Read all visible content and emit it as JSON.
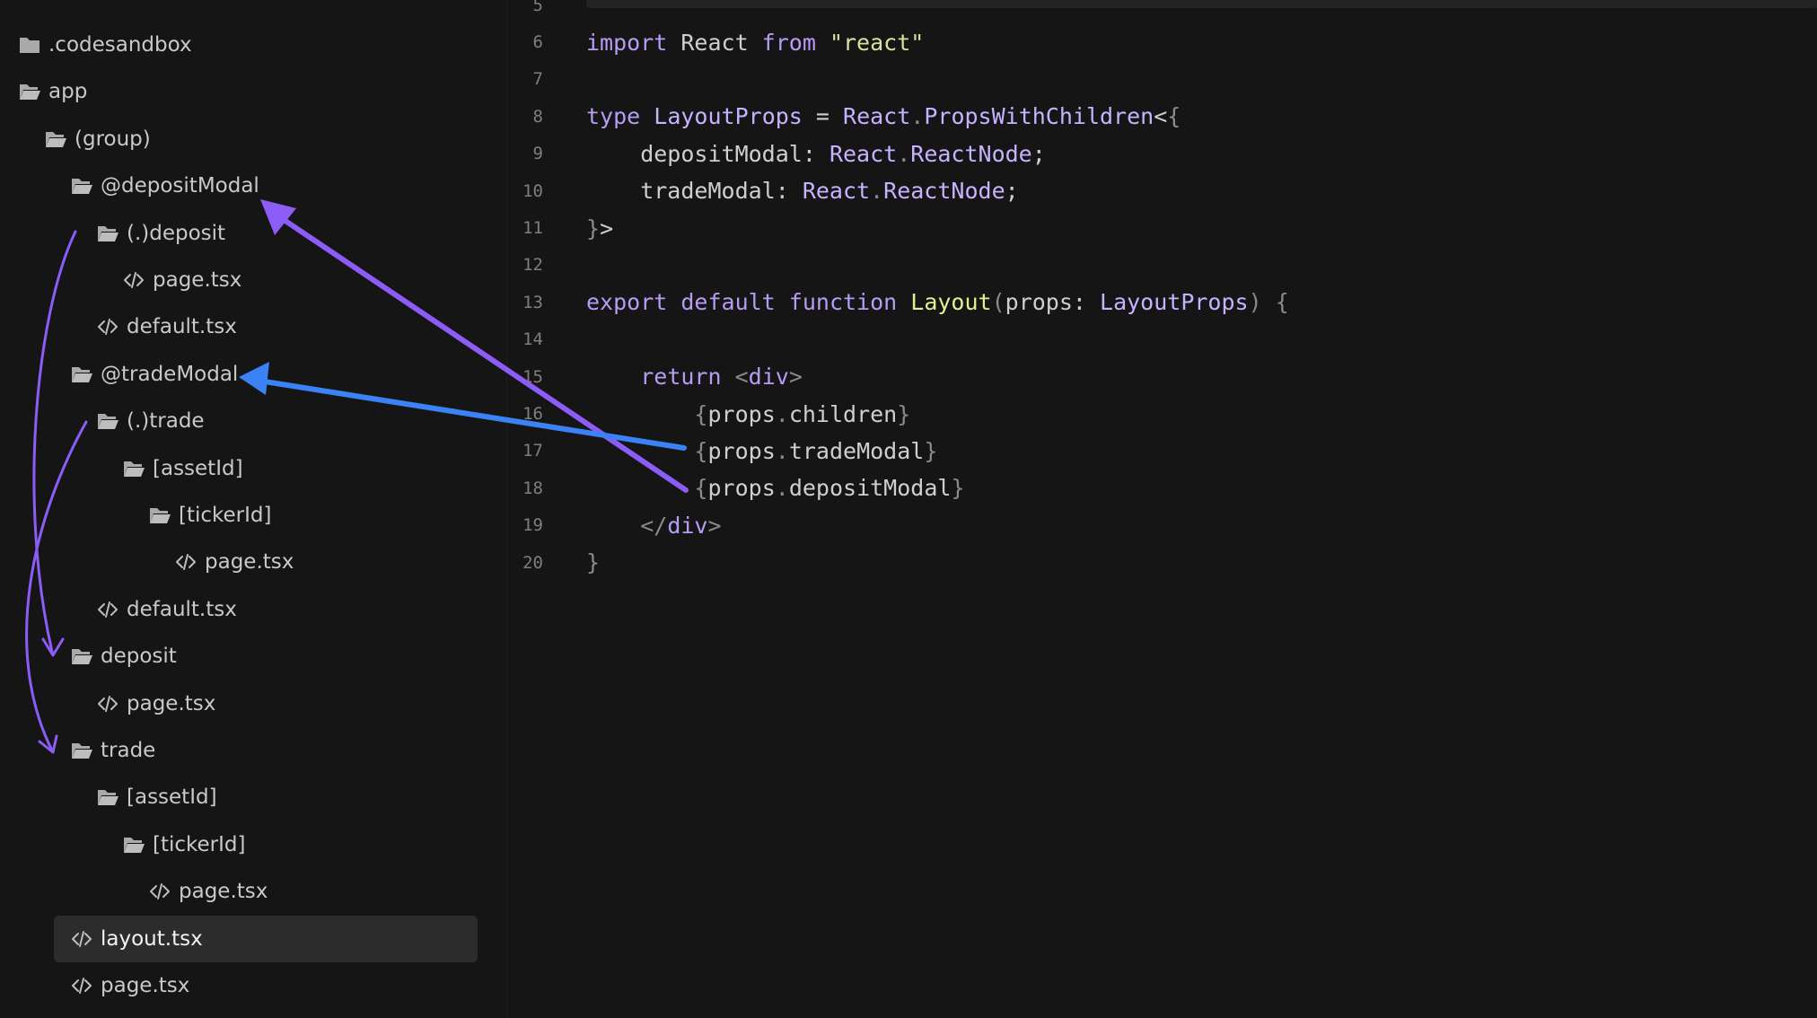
{
  "explorer": {
    "items": [
      {
        "label": ".codesandbox",
        "type": "folder-closed",
        "depth": 0
      },
      {
        "label": "app",
        "type": "folder-open",
        "depth": 0
      },
      {
        "label": "(group)",
        "type": "folder-open",
        "depth": 1
      },
      {
        "label": "@depositModal",
        "type": "folder-open",
        "depth": 2
      },
      {
        "label": "(.)deposit",
        "type": "folder-open",
        "depth": 3
      },
      {
        "label": "page.tsx",
        "type": "file",
        "depth": 4
      },
      {
        "label": "default.tsx",
        "type": "file",
        "depth": 3
      },
      {
        "label": "@tradeModal",
        "type": "folder-open",
        "depth": 2
      },
      {
        "label": "(.)trade",
        "type": "folder-open",
        "depth": 3
      },
      {
        "label": "[assetId]",
        "type": "folder-open",
        "depth": 4
      },
      {
        "label": "[tickerId]",
        "type": "folder-open",
        "depth": 5
      },
      {
        "label": "page.tsx",
        "type": "file",
        "depth": 6
      },
      {
        "label": "default.tsx",
        "type": "file",
        "depth": 3
      },
      {
        "label": "deposit",
        "type": "folder-open",
        "depth": 2
      },
      {
        "label": "page.tsx",
        "type": "file",
        "depth": 3
      },
      {
        "label": "trade",
        "type": "folder-open",
        "depth": 2
      },
      {
        "label": "[assetId]",
        "type": "folder-open",
        "depth": 3
      },
      {
        "label": "[tickerId]",
        "type": "folder-open",
        "depth": 4
      },
      {
        "label": "page.tsx",
        "type": "file",
        "depth": 5
      },
      {
        "label": "layout.tsx",
        "type": "file",
        "depth": 2,
        "active": true
      },
      {
        "label": "page.tsx",
        "type": "file",
        "depth": 2
      }
    ]
  },
  "editor": {
    "lines": [
      {
        "num": "5",
        "current": true,
        "tokens": []
      },
      {
        "num": "6",
        "tokens": [
          [
            "k",
            "import"
          ],
          [
            "t",
            " React "
          ],
          [
            "k",
            "from"
          ],
          [
            "t",
            " "
          ],
          [
            "s",
            "\"react\""
          ]
        ]
      },
      {
        "num": "7",
        "tokens": []
      },
      {
        "num": "8",
        "tokens": [
          [
            "k",
            "type"
          ],
          [
            "t",
            " "
          ],
          [
            "ty",
            "LayoutProps"
          ],
          [
            "t",
            " = "
          ],
          [
            "ty",
            "React"
          ],
          [
            "p",
            "."
          ],
          [
            "ty",
            "PropsWithChildren"
          ],
          [
            "t",
            "<"
          ],
          [
            "p",
            "{"
          ]
        ]
      },
      {
        "num": "9",
        "tokens": [
          [
            "t",
            "    depositModal: "
          ],
          [
            "ty",
            "React"
          ],
          [
            "p",
            "."
          ],
          [
            "ty",
            "ReactNode"
          ],
          [
            "t",
            ";"
          ]
        ]
      },
      {
        "num": "10",
        "tokens": [
          [
            "t",
            "    tradeModal: "
          ],
          [
            "ty",
            "React"
          ],
          [
            "p",
            "."
          ],
          [
            "ty",
            "ReactNode"
          ],
          [
            "t",
            ";"
          ]
        ]
      },
      {
        "num": "11",
        "tokens": [
          [
            "p",
            "}"
          ],
          [
            "t",
            ">"
          ]
        ]
      },
      {
        "num": "12",
        "tokens": []
      },
      {
        "num": "13",
        "tokens": [
          [
            "k",
            "export"
          ],
          [
            "t",
            " "
          ],
          [
            "k",
            "default"
          ],
          [
            "t",
            " "
          ],
          [
            "k",
            "function"
          ],
          [
            "t",
            " "
          ],
          [
            "fn",
            "Layout"
          ],
          [
            "p",
            "("
          ],
          [
            "t",
            "props: "
          ],
          [
            "ty",
            "LayoutProps"
          ],
          [
            "p",
            ")"
          ],
          [
            "t",
            " "
          ],
          [
            "p",
            "{"
          ]
        ]
      },
      {
        "num": "14",
        "tokens": []
      },
      {
        "num": "15",
        "tokens": [
          [
            "t",
            "    "
          ],
          [
            "k",
            "return"
          ],
          [
            "t",
            " "
          ],
          [
            "p",
            "<"
          ],
          [
            "tag",
            "div"
          ],
          [
            "p",
            ">"
          ]
        ]
      },
      {
        "num": "16",
        "tokens": [
          [
            "t",
            "        "
          ],
          [
            "p",
            "{"
          ],
          [
            "t",
            "props"
          ],
          [
            "p",
            "."
          ],
          [
            "t",
            "children"
          ],
          [
            "p",
            "}"
          ]
        ]
      },
      {
        "num": "17",
        "tokens": [
          [
            "t",
            "        "
          ],
          [
            "p",
            "{"
          ],
          [
            "t",
            "props"
          ],
          [
            "p",
            "."
          ],
          [
            "t",
            "tradeModal"
          ],
          [
            "p",
            "}"
          ]
        ]
      },
      {
        "num": "18",
        "tokens": [
          [
            "t",
            "        "
          ],
          [
            "p",
            "{"
          ],
          [
            "t",
            "props"
          ],
          [
            "p",
            "."
          ],
          [
            "t",
            "depositModal"
          ],
          [
            "p",
            "}"
          ]
        ]
      },
      {
        "num": "19",
        "tokens": [
          [
            "t",
            "    "
          ],
          [
            "p",
            "</"
          ],
          [
            "tag",
            "div"
          ],
          [
            "p",
            ">"
          ]
        ]
      },
      {
        "num": "20",
        "tokens": [
          [
            "p",
            "}"
          ]
        ]
      }
    ]
  },
  "colors": {
    "background": "#151515",
    "active_row": "#2c2c2c",
    "keyword": "#b79cf5",
    "string": "#d5e39a",
    "function": "#e4f08f",
    "arrow_purple": "#8b5cf6",
    "arrow_blue": "#3b82f6"
  }
}
